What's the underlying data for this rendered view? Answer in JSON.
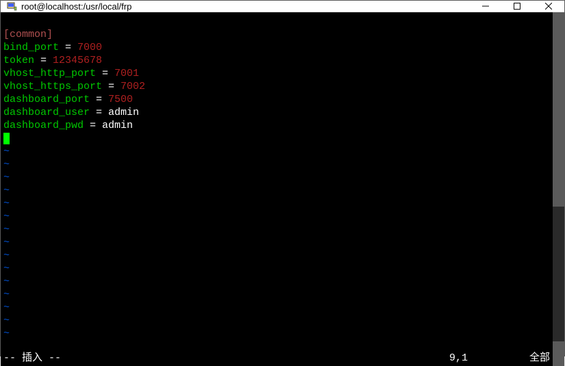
{
  "window": {
    "title": "root@localhost:/usr/local/frp"
  },
  "config": {
    "section": "[common]",
    "lines": [
      {
        "key": "bind_port",
        "eq": " = ",
        "value": "7000",
        "vclass": "num"
      },
      {
        "key": "token",
        "eq": " = ",
        "value": "12345678",
        "vclass": "num"
      },
      {
        "key": "vhost_http_port",
        "eq": " = ",
        "value": "7001",
        "vclass": "num"
      },
      {
        "key": "vhost_https_port",
        "eq": " = ",
        "value": "7002",
        "vclass": "num"
      },
      {
        "key": "dashboard_port",
        "eq": " = ",
        "value": "7500",
        "vclass": "num"
      },
      {
        "key": "dashboard_user",
        "eq": " = ",
        "value": "admin",
        "vclass": "val"
      },
      {
        "key": "dashboard_pwd",
        "eq": " = ",
        "value": "admin",
        "vclass": "val"
      }
    ]
  },
  "tilde": "~",
  "status": {
    "mode": "-- 插入 --",
    "position": "9,1",
    "percent": "全部"
  }
}
